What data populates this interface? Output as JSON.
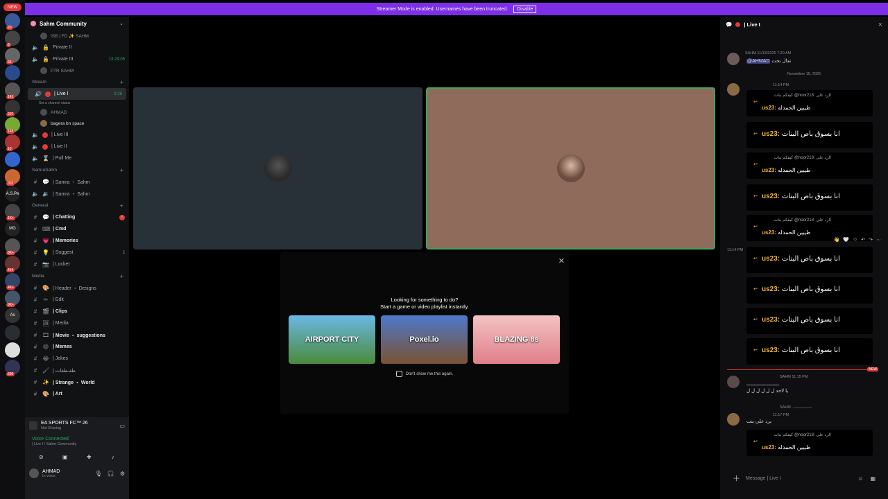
{
  "banner": {
    "text": "Streamer Mode is enabled. Usernames have been truncated.",
    "button": "Disable"
  },
  "rail": {
    "new_badge": "NEW",
    "servers": [
      {
        "label": "",
        "badge": "20"
      },
      {
        "label": "",
        "badge": "8"
      },
      {
        "label": "",
        "badge": "66"
      },
      {
        "label": "",
        "badge": ""
      },
      {
        "label": "",
        "badge": "141"
      },
      {
        "label": "",
        "badge": "207"
      },
      {
        "label": "",
        "badge": "148"
      },
      {
        "label": "",
        "badge": "19"
      },
      {
        "label": "",
        "badge": ""
      },
      {
        "label": "",
        "badge": "303"
      },
      {
        "label": "A.S.Pe",
        "badge": ""
      },
      {
        "label": "",
        "badge": "1K+"
      },
      {
        "label": "MG",
        "badge": ""
      },
      {
        "label": "",
        "badge": "8K+"
      },
      {
        "label": "",
        "badge": "414"
      },
      {
        "label": "",
        "badge": "4K+"
      },
      {
        "label": "",
        "badge": "9K+"
      },
      {
        "label": "As",
        "badge": ""
      },
      {
        "label": "",
        "badge": ""
      },
      {
        "label": "",
        "badge": ""
      },
      {
        "label": "",
        "badge": "690"
      }
    ]
  },
  "sidebar": {
    "server_name": "Sahm Community",
    "top_sub": "ISB | FD ✨ SAHM",
    "private": [
      {
        "label": "Private II",
        "time": ""
      },
      {
        "label": "Private III",
        "time": "13:29:05"
      }
    ],
    "private_sub": "P7R SAHM",
    "cat_stream": "Stream",
    "live1": {
      "label": "| Live I",
      "time": "9:26",
      "status": "Set a channel status"
    },
    "live1_users": [
      "AHMAD",
      "bagera bn space"
    ],
    "stream_channels": [
      "| Live III",
      "| Live II",
      "| Pull Me"
    ],
    "cat_samra": "SamraSahm",
    "samra_channels": [
      "| Samra ・ Sahm",
      "| Samra ・ Sahm"
    ],
    "cat_general": "General",
    "general_channels": [
      {
        "label": "| Chatting",
        "badge": "!"
      },
      {
        "label": "| Cmd",
        "badge": ""
      },
      {
        "label": "| Memories",
        "badge": ""
      },
      {
        "label": "| Suggest",
        "badge": "2"
      },
      {
        "label": "| Locket",
        "badge": ""
      }
    ],
    "cat_media": "Media",
    "media_channels": [
      "| Header ・ Designs",
      "| Edit",
      "| Clips",
      "| Media",
      "| Movie ・ suggestions",
      "| Memes",
      "| Jokes",
      "| طقـطقات",
      "| Strange ・ World",
      "| Art"
    ]
  },
  "panel": {
    "game": "EA SPORTS FC™ 26",
    "game_status": "Not Sharing",
    "voice": "Voice Connected",
    "voice_sub": "| Live I / Sahm Community",
    "user": "AHMAD",
    "user_status": "In voice"
  },
  "activity": {
    "line1": "Looking for something to do?",
    "line2": "Start a game or video playlist instantly.",
    "cards": [
      "AIRPORT CITY",
      "Poxel.io",
      "BLAZING 8s"
    ],
    "dont_show": "Don't show me this again."
  },
  "chat": {
    "channel": "| Live I",
    "m1_meta": "SAHM  11/13/2025 7:20 AM",
    "m1_mention": "@AHMAD",
    "m1_text": "تعال تحت",
    "date": "November 15, 2025",
    "time_a": "11:14 PM",
    "reply_label": "كيفكم بنات @noor218: الرد على",
    "reply_line": "طييين الحمدله",
    "user_tag": "us23:",
    "big_line": "انا بسوق باص البنات",
    "time_side": "11:14 PM",
    "m_sahm_meta": "SAHM  11:15 PM",
    "m_sahm_text1": "ـــــــــــــــــــــــ",
    "m_sahm_text2": "يا لاحد ل ل ل ل ل ل",
    "reply_sahm": "SAHM ...ـــــــــــــــ",
    "time_b": "11:17 PM",
    "m_last_text": "برد على بنت",
    "new_tag": "NEW",
    "placeholder": "Message  | Live I"
  }
}
